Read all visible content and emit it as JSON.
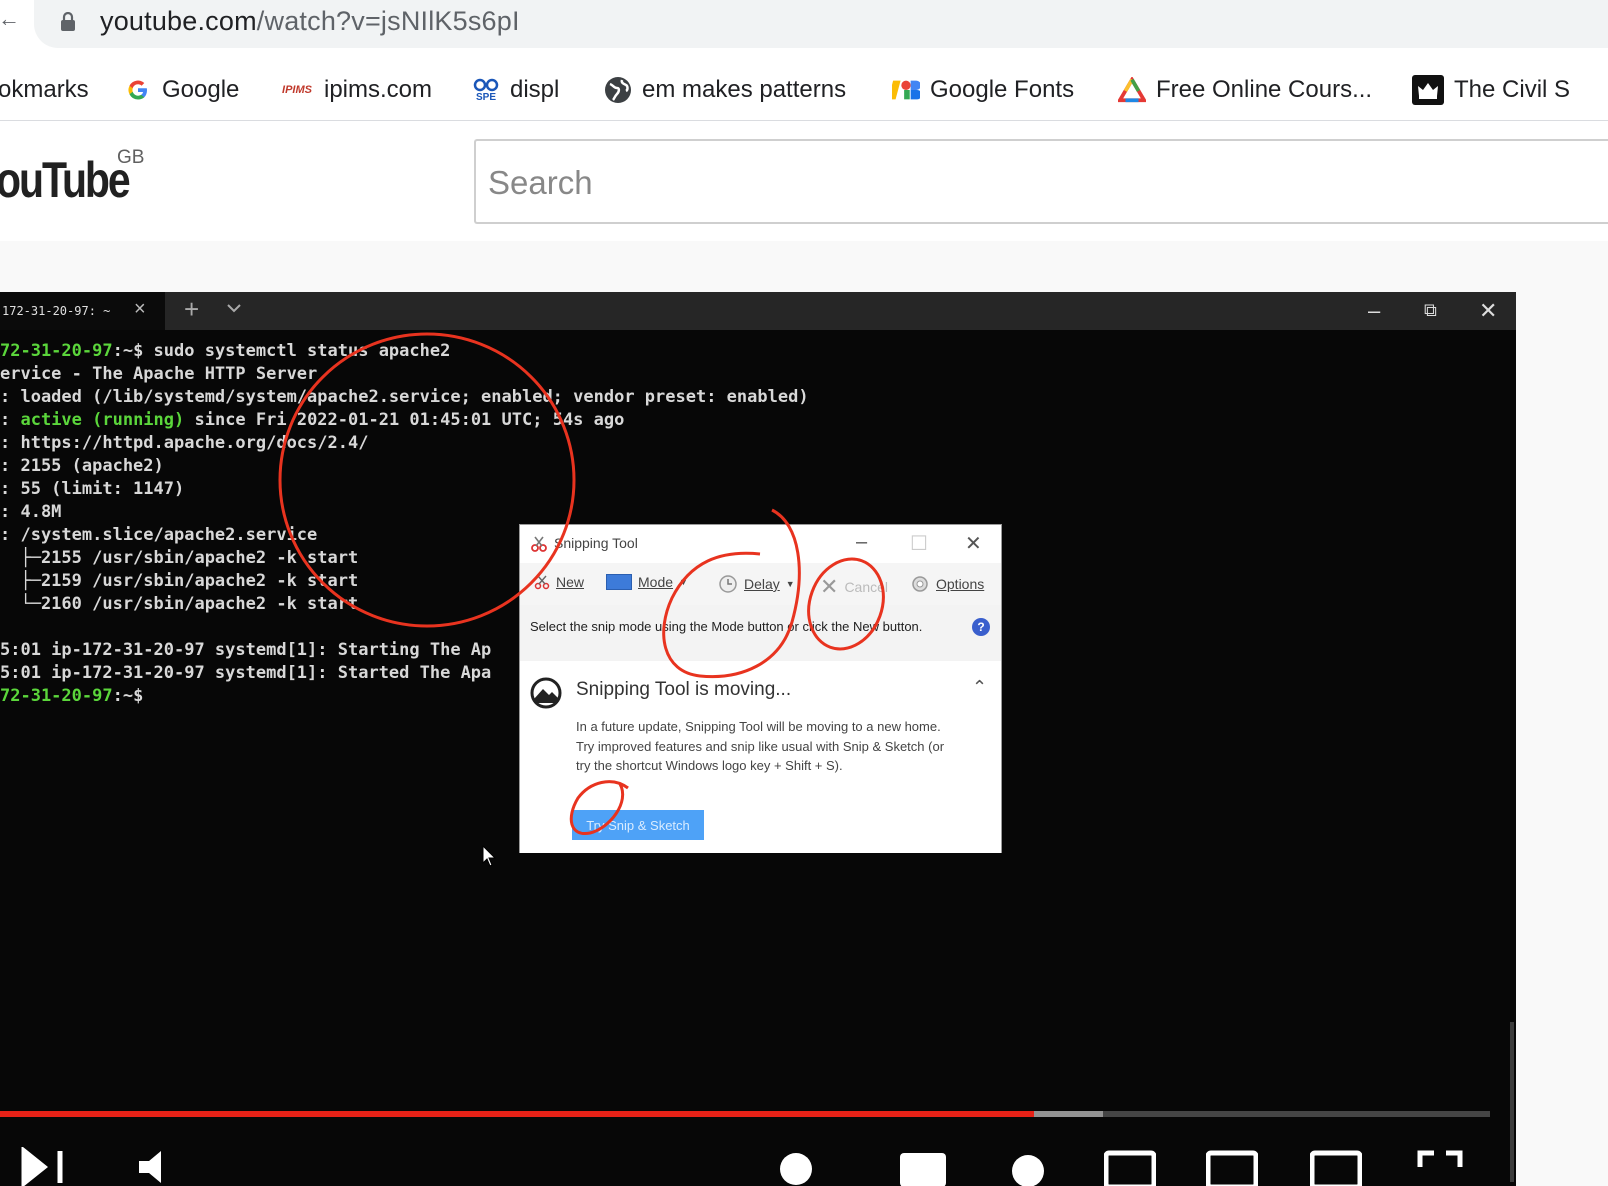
{
  "browser": {
    "url_host": "youtube.com",
    "url_path": "/watch?v=jsNIlK5s6pI",
    "bookmarks": [
      {
        "label": "okmarks",
        "icon": "folder-icon"
      },
      {
        "label": "Google",
        "icon": "google-icon"
      },
      {
        "label": "ipims.com",
        "icon": "ipims-icon"
      },
      {
        "label": "displ",
        "icon": "spe-icon"
      },
      {
        "label": "em makes patterns",
        "icon": "globe-icon"
      },
      {
        "label": "Google Fonts",
        "icon": "google-fonts-icon"
      },
      {
        "label": "Free Online Cours...",
        "icon": "courses-icon"
      },
      {
        "label": "The Civil S",
        "icon": "crown-icon"
      }
    ]
  },
  "youtube": {
    "logo": "ouTube",
    "country": "GB",
    "search_placeholder": "Search"
  },
  "video": {
    "terminal": {
      "tab_title": "172-31-20-97: ~",
      "lines": [
        {
          "parts": [
            {
              "t": "72-31-20-97",
              "c": "g"
            },
            {
              "t": ":~$ sudo systemctl status apache2",
              "c": ""
            }
          ]
        },
        {
          "parts": [
            {
              "t": "ervice - The Apache HTTP Server",
              "c": ""
            }
          ]
        },
        {
          "parts": [
            {
              "t": ": loaded (/lib/systemd/system/apache2.service; enabled; vendor preset: enabled)",
              "c": ""
            }
          ]
        },
        {
          "parts": [
            {
              "t": ": ",
              "c": ""
            },
            {
              "t": "active (running)",
              "c": "g"
            },
            {
              "t": " since Fri 2022-01-21 01:45:01 UTC; 54s ago",
              "c": ""
            }
          ]
        },
        {
          "parts": [
            {
              "t": ": https://httpd.apache.org/docs/2.4/",
              "c": ""
            }
          ]
        },
        {
          "parts": [
            {
              "t": ": 2155 (apache2)",
              "c": ""
            }
          ]
        },
        {
          "parts": [
            {
              "t": ": 55 (limit: 1147)",
              "c": ""
            }
          ]
        },
        {
          "parts": [
            {
              "t": ": 4.8M",
              "c": ""
            }
          ]
        },
        {
          "parts": [
            {
              "t": ": /system.slice/apache2.service",
              "c": ""
            }
          ]
        },
        {
          "parts": [
            {
              "t": "  ├─2155 /usr/sbin/apache2 -k start",
              "c": ""
            }
          ]
        },
        {
          "parts": [
            {
              "t": "  ├─2159 /usr/sbin/apache2 -k start",
              "c": ""
            }
          ]
        },
        {
          "parts": [
            {
              "t": "  └─2160 /usr/sbin/apache2 -k start",
              "c": ""
            }
          ]
        },
        {
          "parts": [
            {
              "t": "",
              "c": ""
            }
          ]
        },
        {
          "parts": [
            {
              "t": "5:01 ip-172-31-20-97 systemd[1]: Starting The Ap",
              "c": ""
            }
          ]
        },
        {
          "parts": [
            {
              "t": "5:01 ip-172-31-20-97 systemd[1]: Started The Apa",
              "c": ""
            }
          ]
        },
        {
          "parts": [
            {
              "t": "72-31-20-97",
              "c": "g"
            },
            {
              "t": ":~$",
              "c": ""
            }
          ]
        }
      ]
    },
    "snipping_tool": {
      "title": "Snipping Tool",
      "toolbar": {
        "new": "New",
        "mode": "Mode",
        "delay": "Delay",
        "cancel": "Cancel",
        "options": "Options"
      },
      "hint": "Select the snip mode using the Mode button or click the New button.",
      "panel_title": "Snipping Tool is moving...",
      "panel_body": "In a future update, Snipping Tool will be moving to a new home. Try improved features and snip like usual with Snip & Sketch (or try the shortcut Windows logo key + Shift + S).",
      "try_button": "Try Snip & Sketch"
    },
    "progress": {
      "played_fraction": 0.694,
      "buffered_fraction": 0.74
    },
    "colors": {
      "progress_played": "#e62117",
      "annotation": "#e8331f",
      "terminal_green": "#5bd63b"
    }
  }
}
